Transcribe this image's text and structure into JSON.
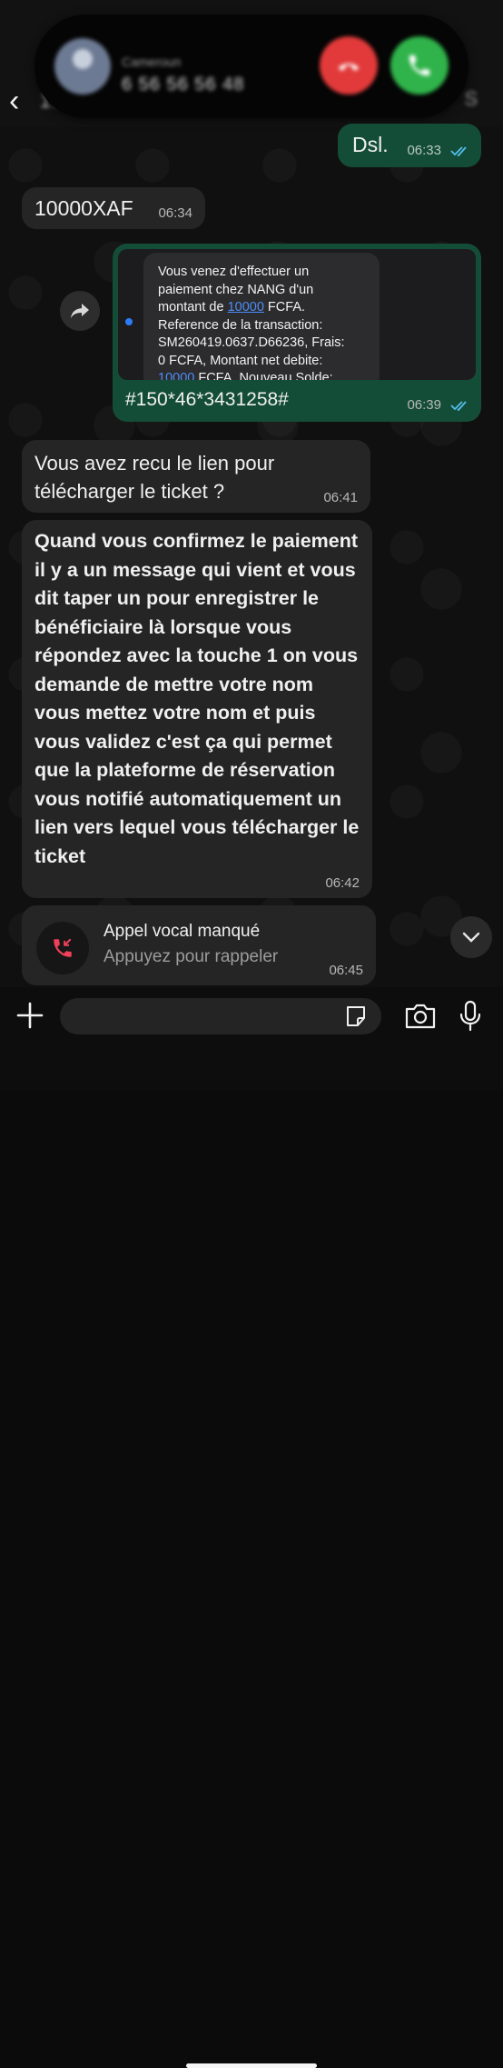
{
  "header": {
    "back_glyph": "‹",
    "contact_name": "1…",
    "right_icons": "S"
  },
  "call_banner": {
    "carrier_tag": "Cameroun",
    "phone_number": "6 56 56 56 48"
  },
  "messages": [
    {
      "direction": "out",
      "text": "Dsl.",
      "time": "06:33",
      "read": true
    },
    {
      "direction": "in",
      "text": "10000XAF",
      "time": "06:34"
    },
    {
      "direction": "out",
      "type": "image",
      "sms_lines": [
        "Vous venez d'effectuer un",
        "paiement chez NANG d'un",
        "montant de ",
        "10000",
        " FCFA.",
        "Reference de la transaction:",
        "SM260419.0637.D66236, Frais:",
        "0 FCFA, Montant net debite:",
        "10000",
        " FCFA. Nouveau Solde:"
      ],
      "caption": "#150*46*3431258#",
      "time": "06:39",
      "read": true
    },
    {
      "direction": "in",
      "text": "Vous avez recu le lien pour télécharger le ticket ?",
      "time": "06:41"
    },
    {
      "direction": "in",
      "text": "Quand vous confirmez le paiement il y a un message qui vient et vous dit taper un pour enregistrer le bénéficiaire là lorsque vous répondez avec la touche 1 on vous demande de mettre votre nom vous mettez votre nom et puis vous validez c'est ça qui permet que la plateforme de réservation vous notifié automatiquement un lien vers lequel vous télécharger le ticket",
      "time": "06:42"
    },
    {
      "direction": "in",
      "type": "missed_call",
      "title": "Appel vocal manqué",
      "subtitle": "Appuyez pour rappeler",
      "time": "06:45"
    }
  ],
  "composer": {
    "placeholder": "",
    "value": ""
  },
  "colors": {
    "outgoing_bubble": "#144d37",
    "incoming_bubble": "#252525",
    "read_ticks": "#53bdeb",
    "decline": "#e23a3a",
    "accept": "#2fb34a"
  }
}
